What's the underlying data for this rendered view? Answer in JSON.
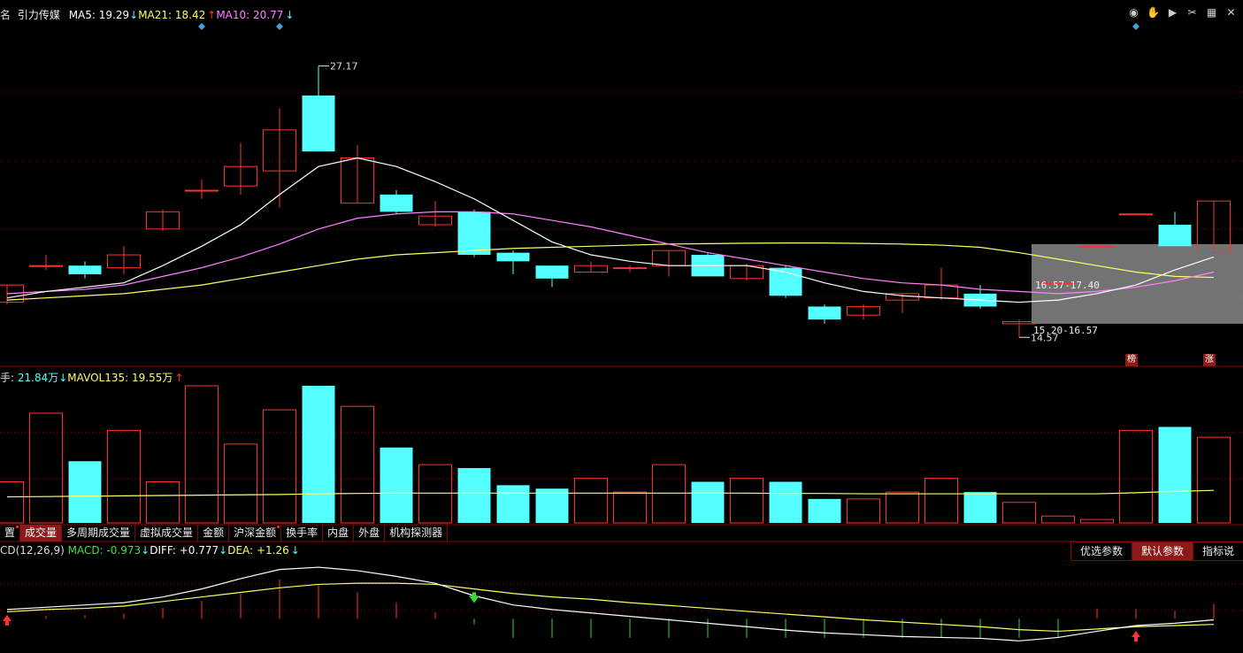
{
  "header": {
    "prefix": "名",
    "stock_name": "引力传媒",
    "ma5": {
      "label": "MA5:",
      "value": "19.29",
      "arrow": "↓"
    },
    "ma21": {
      "label": "MA21:",
      "value": "18.42",
      "arrow": "↑"
    },
    "ma10": {
      "label": "MA10:",
      "value": "20.77",
      "arrow": "↓"
    }
  },
  "vol_header": {
    "prefix": "手:",
    "vol_value": "21.84万",
    "vol_arrow": "↓",
    "mavol": {
      "label": "MAVOL135:",
      "value": "19.55万",
      "arrow": "↑"
    }
  },
  "macd_header": {
    "label": "CD(12,26,9)",
    "macd": {
      "label": "MACD:",
      "value": "-0.973",
      "arrow": "↓"
    },
    "diff": {
      "label": "DIFF:",
      "value": "+0.777",
      "arrow": "↓"
    },
    "dea": {
      "label": "DEA:",
      "value": "+1.26",
      "arrow": "↓"
    }
  },
  "tabs": [
    {
      "label": "置",
      "active": false,
      "dot": true
    },
    {
      "label": "成交量",
      "active": true,
      "dot": false
    },
    {
      "label": "多周期成交量",
      "active": false,
      "dot": false
    },
    {
      "label": "虚拟成交量",
      "active": false,
      "dot": false
    },
    {
      "label": "金额",
      "active": false,
      "dot": false
    },
    {
      "label": "沪深金额",
      "active": false,
      "dot": true
    },
    {
      "label": "换手率",
      "active": false,
      "dot": false
    },
    {
      "label": "内盘",
      "active": false,
      "dot": false
    },
    {
      "label": "外盘",
      "active": false,
      "dot": false
    },
    {
      "label": "机构探测器",
      "active": false,
      "dot": false
    }
  ],
  "param_buttons": [
    {
      "label": "优选参数",
      "active": false
    },
    {
      "label": "默认参数",
      "active": true
    },
    {
      "label": "指标说",
      "active": false
    }
  ],
  "toolbar_icons": [
    "eye-icon",
    "hand-icon",
    "play-icon",
    "scissors-icon",
    "grid-icon",
    "close-icon"
  ],
  "badges": {
    "rank": "榜",
    "rise": "涨"
  },
  "colors": {
    "up": "#ff3232",
    "down": "#54ffff",
    "ma5": "#ffffff",
    "ma10": "#ff80ff",
    "ma21": "#ffff66",
    "grid": "#8b0000",
    "diamond": "#3fa0d8",
    "box": "#9a9a9a"
  },
  "chart_data": {
    "type": "candlestick",
    "price": {
      "ylim": [
        13.8,
        29.0
      ],
      "candles": [
        {
          "o": 16.2,
          "c": 17.0,
          "h": 17.0,
          "l": 16.1
        },
        {
          "o": 17.9,
          "c": 17.9,
          "h": 18.4,
          "l": 17.7
        },
        {
          "o": 17.9,
          "c": 17.5,
          "h": 18.1,
          "l": 17.3
        },
        {
          "o": 17.8,
          "c": 18.4,
          "h": 18.8,
          "l": 17.5
        },
        {
          "o": 19.6,
          "c": 20.4,
          "h": 20.5,
          "l": 19.5
        },
        {
          "o": 21.4,
          "c": 21.4,
          "h": 21.9,
          "l": 21.0
        },
        {
          "o": 21.6,
          "c": 22.5,
          "h": 23.6,
          "l": 21.2
        },
        {
          "o": 22.3,
          "c": 24.2,
          "h": 25.2,
          "l": 20.6
        },
        {
          "o": 25.8,
          "c": 23.2,
          "h": 27.17,
          "l": 23.2
        },
        {
          "o": 20.8,
          "c": 22.9,
          "h": 23.5,
          "l": 20.8
        },
        {
          "o": 21.2,
          "c": 20.4,
          "h": 21.4,
          "l": 20.3
        },
        {
          "o": 19.8,
          "c": 20.2,
          "h": 20.9,
          "l": 19.7
        },
        {
          "o": 20.4,
          "c": 18.4,
          "h": 20.5,
          "l": 18.3
        },
        {
          "o": 18.5,
          "c": 18.1,
          "h": 18.6,
          "l": 17.5
        },
        {
          "o": 17.9,
          "c": 17.3,
          "h": 17.9,
          "l": 16.9
        },
        {
          "o": 17.6,
          "c": 17.9,
          "h": 18.1,
          "l": 17.6
        },
        {
          "o": 17.8,
          "c": 17.8,
          "h": 17.9,
          "l": 17.6
        },
        {
          "o": 17.9,
          "c": 18.6,
          "h": 18.6,
          "l": 17.4
        },
        {
          "o": 18.4,
          "c": 17.4,
          "h": 18.5,
          "l": 17.4
        },
        {
          "o": 17.3,
          "c": 17.9,
          "h": 18.0,
          "l": 17.2
        },
        {
          "o": 17.8,
          "c": 16.5,
          "h": 17.9,
          "l": 16.4
        },
        {
          "o": 16.0,
          "c": 15.4,
          "h": 16.1,
          "l": 15.2
        },
        {
          "o": 15.6,
          "c": 16.0,
          "h": 16.1,
          "l": 15.4
        },
        {
          "o": 16.3,
          "c": 16.6,
          "h": 16.6,
          "l": 15.7
        },
        {
          "o": 16.4,
          "c": 17.0,
          "h": 17.8,
          "l": 16.3
        },
        {
          "o": 16.6,
          "c": 16.0,
          "h": 17.0,
          "l": 15.9
        },
        {
          "o": 15.2,
          "c": 15.3,
          "h": 15.4,
          "l": 14.57
        },
        {
          "o": 17.1,
          "c": 17.1,
          "h": 17.1,
          "l": 17.1
        },
        {
          "o": 18.8,
          "c": 18.8,
          "h": 18.8,
          "l": 18.8
        },
        {
          "o": 20.3,
          "c": 20.3,
          "h": 20.3,
          "l": 20.3
        },
        {
          "o": 19.8,
          "c": 18.8,
          "h": 20.4,
          "l": 18.8
        },
        {
          "o": 18.5,
          "c": 20.9,
          "h": 20.9,
          "l": 18.5
        }
      ],
      "ma5": [
        16.4,
        16.7,
        16.9,
        17.1,
        17.9,
        18.8,
        19.8,
        21.2,
        22.5,
        22.9,
        22.5,
        21.8,
        21.0,
        20.0,
        19.0,
        18.4,
        18.1,
        17.9,
        17.9,
        17.9,
        17.6,
        17.1,
        16.7,
        16.5,
        16.4,
        16.3,
        16.2,
        16.3,
        16.6,
        17.0,
        17.7,
        18.3
      ],
      "ma10": [
        16.6,
        16.7,
        16.8,
        17.0,
        17.4,
        17.8,
        18.3,
        18.9,
        19.6,
        20.1,
        20.3,
        20.4,
        20.4,
        20.3,
        20.0,
        19.7,
        19.3,
        18.9,
        18.5,
        18.2,
        17.9,
        17.6,
        17.3,
        17.1,
        17.0,
        16.8,
        16.7,
        16.6,
        16.7,
        16.9,
        17.2,
        17.6
      ],
      "ma21": [
        16.3,
        16.4,
        16.5,
        16.6,
        16.8,
        17.0,
        17.3,
        17.6,
        17.9,
        18.2,
        18.4,
        18.5,
        18.6,
        18.7,
        18.75,
        18.8,
        18.85,
        18.9,
        18.92,
        18.94,
        18.95,
        18.95,
        18.93,
        18.9,
        18.85,
        18.75,
        18.5,
        18.2,
        17.9,
        17.6,
        17.4,
        17.35
      ],
      "high_label": "27.17",
      "low_label": "14.57",
      "range_labels": [
        "16.57-17.40",
        "15.20-16.57"
      ],
      "diamond_marker_indices": [
        5,
        7,
        29
      ]
    },
    "volume": {
      "ylim": [
        0,
        40
      ],
      "values": [
        12,
        32,
        18,
        27,
        12,
        40,
        23,
        33,
        40,
        34,
        22,
        17,
        16,
        11,
        10,
        13,
        9,
        17,
        12,
        13,
        12,
        7,
        7,
        9,
        13,
        9,
        6,
        2,
        1,
        27,
        28,
        25
      ],
      "mavol": [
        7.6,
        7.7,
        7.8,
        7.9,
        8.0,
        8.1,
        8.2,
        8.3,
        8.5,
        8.6,
        8.7,
        8.7,
        8.7,
        8.7,
        8.7,
        8.7,
        8.7,
        8.7,
        8.7,
        8.7,
        8.6,
        8.6,
        8.5,
        8.5,
        8.5,
        8.5,
        8.5,
        8.5,
        8.5,
        8.8,
        9.2,
        9.5
      ]
    },
    "macd": {
      "ylim": [
        -1.5,
        2.6
      ],
      "bars": [
        0.05,
        0.12,
        0.16,
        0.22,
        0.48,
        0.78,
        1.1,
        1.72,
        1.46,
        1.15,
        0.7,
        0.28,
        -0.25,
        -0.84,
        -0.84,
        -0.84,
        -0.84,
        -0.84,
        -0.84,
        -0.84,
        -0.84,
        -0.84,
        -0.84,
        -0.84,
        -0.84,
        -0.84,
        -0.84,
        -0.84,
        0.45,
        0.41,
        0.34,
        0.64
      ],
      "diff": [
        0.4,
        0.5,
        0.6,
        0.7,
        0.95,
        1.3,
        1.75,
        2.15,
        2.25,
        2.1,
        1.85,
        1.55,
        1.0,
        0.6,
        0.4,
        0.25,
        0.1,
        -0.05,
        -0.2,
        -0.35,
        -0.5,
        -0.62,
        -0.7,
        -0.78,
        -0.82,
        -0.86,
        -0.97,
        -0.82,
        -0.55,
        -0.3,
        -0.2,
        -0.05
      ],
      "dea": [
        0.3,
        0.4,
        0.45,
        0.55,
        0.75,
        0.95,
        1.15,
        1.35,
        1.5,
        1.55,
        1.55,
        1.5,
        1.3,
        1.1,
        0.95,
        0.85,
        0.7,
        0.58,
        0.45,
        0.32,
        0.2,
        0.08,
        -0.05,
        -0.15,
        -0.25,
        -0.35,
        -0.48,
        -0.55,
        -0.45,
        -0.35,
        -0.3,
        -0.25
      ],
      "cross_markers": [
        {
          "index": 0,
          "type": "up"
        },
        {
          "index": 12,
          "type": "down"
        },
        {
          "index": 29,
          "type": "up"
        }
      ]
    }
  }
}
